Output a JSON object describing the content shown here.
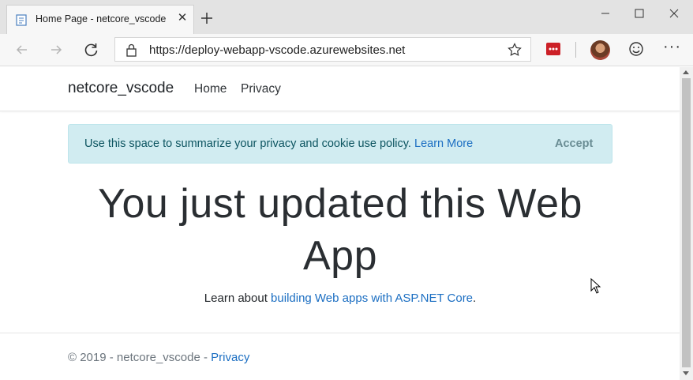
{
  "browser": {
    "tab_title": "Home Page - netcore_vscode",
    "url": "https://deploy-webapp-vscode.azurewebsites.net",
    "icons": [
      "page-favicon-icon",
      "close-tab-icon",
      "new-tab-icon",
      "minimize-icon",
      "maximize-icon",
      "close-window-icon",
      "back-icon",
      "forward-icon",
      "reload-icon",
      "lock-icon",
      "favorite-star-icon",
      "extension-icon",
      "avatar",
      "smiley-icon",
      "more-icon"
    ]
  },
  "site": {
    "brand": "netcore_vscode",
    "nav": {
      "home": "Home",
      "privacy": "Privacy"
    },
    "cookie": {
      "text": "Use this space to summarize your privacy and cookie use policy.",
      "link": "Learn More",
      "accept": "Accept"
    },
    "hero": "You just updated this Web App",
    "lead": {
      "prefix": "Learn about",
      "link": "building Web apps with ASP.NET Core",
      "suffix": "."
    },
    "footer": {
      "text": "© 2019 - netcore_vscode -",
      "link": "Privacy"
    }
  },
  "colors": {
    "link": "#1b6ec2",
    "alert_bg": "#d1ecf1",
    "alert_text": "#0c5460"
  }
}
